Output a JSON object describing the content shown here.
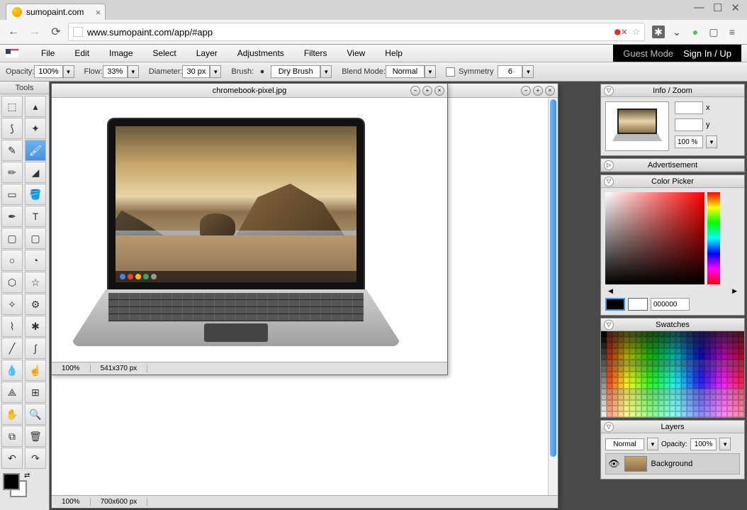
{
  "browser": {
    "tab_title": "sumopaint.com",
    "url": "www.sumopaint.com/app/#app"
  },
  "menubar": {
    "items": [
      "File",
      "Edit",
      "Image",
      "Select",
      "Layer",
      "Adjustments",
      "Filters",
      "View",
      "Help"
    ],
    "guest_mode": "Guest Mode",
    "signin": "Sign In / Up"
  },
  "options": {
    "opacity_label": "Opacity:",
    "opacity_value": "100%",
    "flow_label": "Flow:",
    "flow_value": "33%",
    "diameter_label": "Diameter:",
    "diameter_value": "30 px",
    "brush_label": "Brush:",
    "brush_value": "Dry Brush",
    "blend_label": "Blend Mode:",
    "blend_value": "Normal",
    "symmetry_label": "Symmetry",
    "symmetry_value": "6"
  },
  "tools": {
    "header": "Tools"
  },
  "documents": {
    "front": {
      "title": "chromebook-pixel.jpg",
      "zoom": "100%",
      "dims": "541x370 px"
    },
    "back": {
      "zoom": "100%",
      "dims": "700x600 px"
    }
  },
  "panels": {
    "info_zoom": {
      "title": "Info / Zoom",
      "x_label": "x",
      "y_label": "y",
      "zoom_value": "100 %"
    },
    "advertisement": {
      "title": "Advertisement"
    },
    "color_picker": {
      "title": "Color Picker",
      "hex": "000000"
    },
    "swatches": {
      "title": "Swatches"
    },
    "layers": {
      "title": "Layers",
      "blend_mode": "Normal",
      "opacity_label": "Opacity:",
      "opacity_value": "100%",
      "layer0_name": "Background"
    }
  }
}
